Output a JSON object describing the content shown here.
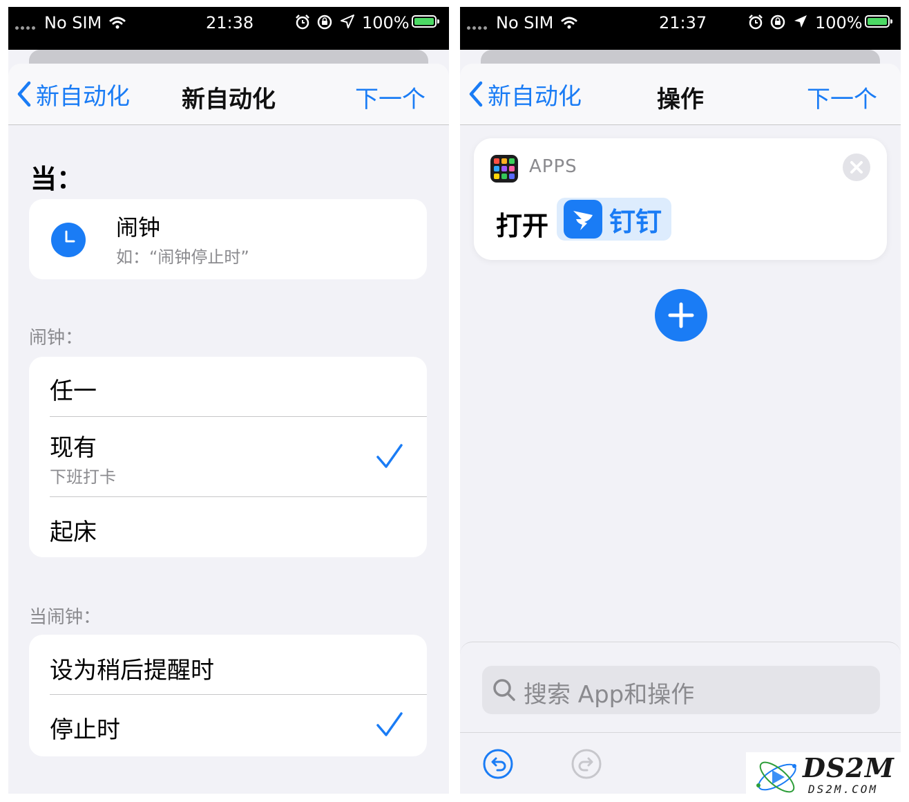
{
  "left": {
    "status": {
      "carrier": "No SIM",
      "time": "21:38",
      "battery": "100%"
    },
    "nav": {
      "back_label": "新自动化",
      "title": "新自动化",
      "next_label": "下一个"
    },
    "when_label": "当：",
    "trigger": {
      "title": "闹钟",
      "subtitle": "如：“闹钟停止时”"
    },
    "alarm_section": {
      "label": "闹钟：",
      "rows": [
        {
          "label": "任一"
        },
        {
          "label": "现有",
          "sublabel": "下班打卡",
          "checked": true
        },
        {
          "label": "起床"
        }
      ]
    },
    "when_alarm_section": {
      "label": "当闹钟：",
      "rows": [
        {
          "label": "设为稍后提醒时"
        },
        {
          "label": "停止时",
          "checked": true
        }
      ]
    }
  },
  "right": {
    "status": {
      "carrier": "No SIM",
      "time": "21:37",
      "battery": "100%"
    },
    "nav": {
      "back_label": "新自动化",
      "title": "操作",
      "next_label": "下一个"
    },
    "action": {
      "category": "APPS",
      "verb": "打开",
      "app_name": "钉钉"
    },
    "search": {
      "placeholder": "搜索 App和操作"
    }
  },
  "watermark": {
    "text": "DS2M",
    "sub": "DS2M.COM"
  },
  "colors": {
    "accent": "#1a7cf5",
    "background": "#f2f2f7",
    "secondary_text": "#8a8a8e"
  }
}
